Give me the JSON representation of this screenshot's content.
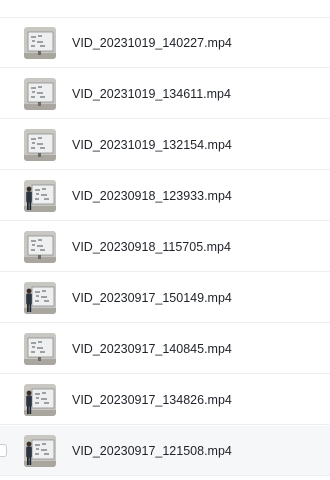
{
  "files": [
    {
      "name": "VID_20231019_140227.mp4",
      "thumbnail": "whiteboard-video-thumbnail-icon",
      "presenter": false
    },
    {
      "name": "VID_20231019_134611.mp4",
      "thumbnail": "whiteboard-video-thumbnail-icon",
      "presenter": false
    },
    {
      "name": "VID_20231019_132154.mp4",
      "thumbnail": "whiteboard-video-thumbnail-icon",
      "presenter": false
    },
    {
      "name": "VID_20230918_123933.mp4",
      "thumbnail": "whiteboard-presenter-video-thumbnail-icon",
      "presenter": true
    },
    {
      "name": "VID_20230918_115705.mp4",
      "thumbnail": "whiteboard-video-thumbnail-icon",
      "presenter": false
    },
    {
      "name": "VID_20230917_150149.mp4",
      "thumbnail": "whiteboard-presenter-video-thumbnail-icon",
      "presenter": true
    },
    {
      "name": "VID_20230917_140845.mp4",
      "thumbnail": "whiteboard-video-thumbnail-icon",
      "presenter": false
    },
    {
      "name": "VID_20230917_134826.mp4",
      "thumbnail": "whiteboard-presenter-video-thumbnail-icon",
      "presenter": true
    },
    {
      "name": "VID_20230917_121508.mp4",
      "thumbnail": "whiteboard-presenter-video-thumbnail-icon",
      "presenter": true,
      "hovered": true
    }
  ],
  "colors": {
    "text": "#1f2329",
    "divider": "#eceef1",
    "hover_background": "#f6f7f9"
  }
}
